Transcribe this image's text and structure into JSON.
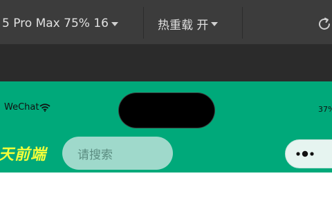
{
  "toolbar": {
    "device_label": "5 Pro Max 75% 16",
    "hot_reload_label": "热重载 开",
    "icons": {
      "device_caret": "chevron-down-icon",
      "hot_reload_caret": "chevron-down-icon",
      "refresh": "refresh-icon"
    }
  },
  "simulator": {
    "status_bar": {
      "carrier": "WeChat",
      "battery": "37%",
      "wifi_icon": "wifi-icon"
    },
    "nav": {
      "brand": "天前端",
      "search_placeholder": "请搜索",
      "capsule_icon": "more-dots-icon"
    },
    "colors": {
      "header_bg": "#00a97a",
      "brand_text": "#f3ff3a",
      "search_bg": "#9fd9cb"
    }
  }
}
